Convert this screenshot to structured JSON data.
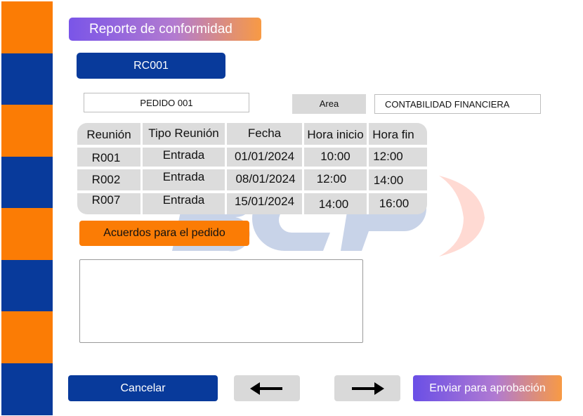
{
  "header": {
    "title": "Reporte de conformidad",
    "code": "RC001"
  },
  "order": {
    "pedido": "PEDIDO 001",
    "area_label": "Area",
    "area_value": "CONTABILIDAD FINANCIERA"
  },
  "meetings": {
    "headers": [
      "Reunión",
      "Tipo Reunión",
      "Fecha",
      "Hora inicio",
      "Hora fin"
    ],
    "rows": [
      [
        "R001",
        "Entrada",
        "01/01/2024",
        "10:00",
        "12:00"
      ],
      [
        "R002",
        "Entrada",
        "08/01/2024",
        "12:00",
        "14:00"
      ],
      [
        "R007",
        "Entrada",
        "15/01/2024",
        "14:00",
        "16:00"
      ]
    ]
  },
  "agreements": {
    "label": "Acuerdos para el pedido",
    "text": ""
  },
  "actions": {
    "cancel": "Cancelar",
    "prev_icon": "arrow-left-icon",
    "next_icon": "arrow-right-icon",
    "send": "Enviar para aprobación"
  },
  "colors": {
    "navy": "#083a9b",
    "orange": "#fb7c05",
    "gray": "#d9d9d9",
    "purple": "#6a4fe6"
  }
}
